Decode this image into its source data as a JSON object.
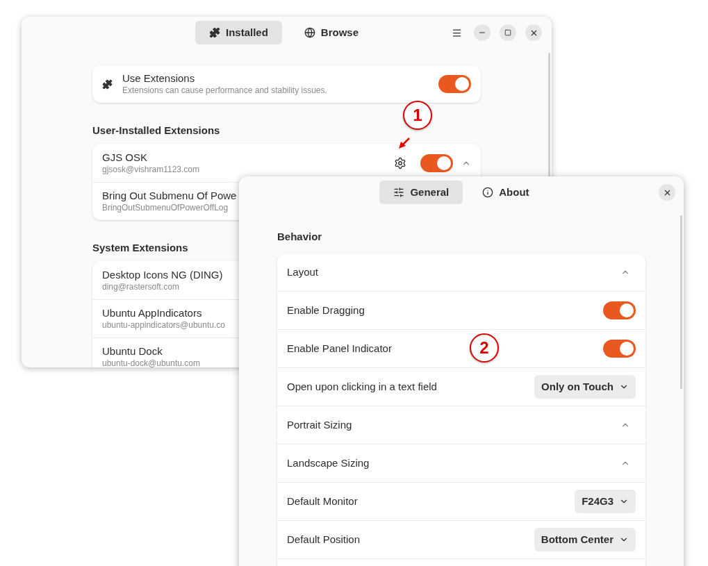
{
  "main_window": {
    "tabs": [
      {
        "label": "Installed",
        "selected": true
      },
      {
        "label": "Browse",
        "selected": false
      }
    ],
    "use_extensions": {
      "title": "Use Extensions",
      "subtitle": "Extensions can cause performance and stability issues.",
      "on": true
    },
    "sections": [
      {
        "heading": "User-Installed Extensions",
        "items": [
          {
            "name": "GJS OSK",
            "id": "gjsosk@vishram1123.com",
            "kind": "expandable",
            "on": true
          },
          {
            "name": "Bring Out Submenu Of Powe",
            "id": "BringOutSubmenuOfPowerOffLog"
          }
        ]
      },
      {
        "heading": "System Extensions",
        "items": [
          {
            "name": "Desktop Icons NG (DING)",
            "id": "ding@rastersoft.com"
          },
          {
            "name": "Ubuntu AppIndicators",
            "id": "ubuntu-appindicators@ubuntu.co"
          },
          {
            "name": "Ubuntu Dock",
            "id": "ubuntu-dock@ubuntu.com"
          }
        ]
      }
    ]
  },
  "dialog": {
    "tabs": [
      {
        "label": "General",
        "selected": true
      },
      {
        "label": "About",
        "selected": false
      }
    ],
    "sections": [
      {
        "heading": "Behavior",
        "rows": [
          {
            "kind": "expander",
            "label": "Layout"
          },
          {
            "kind": "switch",
            "label": "Enable Dragging",
            "on": true
          },
          {
            "kind": "switch",
            "label": "Enable Panel Indicator",
            "on": true
          },
          {
            "kind": "dropdown",
            "label": "Open upon clicking in a text field",
            "value": "Only on Touch"
          },
          {
            "kind": "expander",
            "label": "Portrait Sizing"
          },
          {
            "kind": "expander",
            "label": "Landscape Sizing"
          },
          {
            "kind": "dropdown",
            "label": "Default Monitor",
            "value": "F24G3"
          },
          {
            "kind": "dropdown",
            "label": "Default Position",
            "value": "Bottom Center"
          }
        ]
      }
    ]
  },
  "annotations": [
    {
      "label": "1"
    },
    {
      "label": "2"
    }
  ]
}
